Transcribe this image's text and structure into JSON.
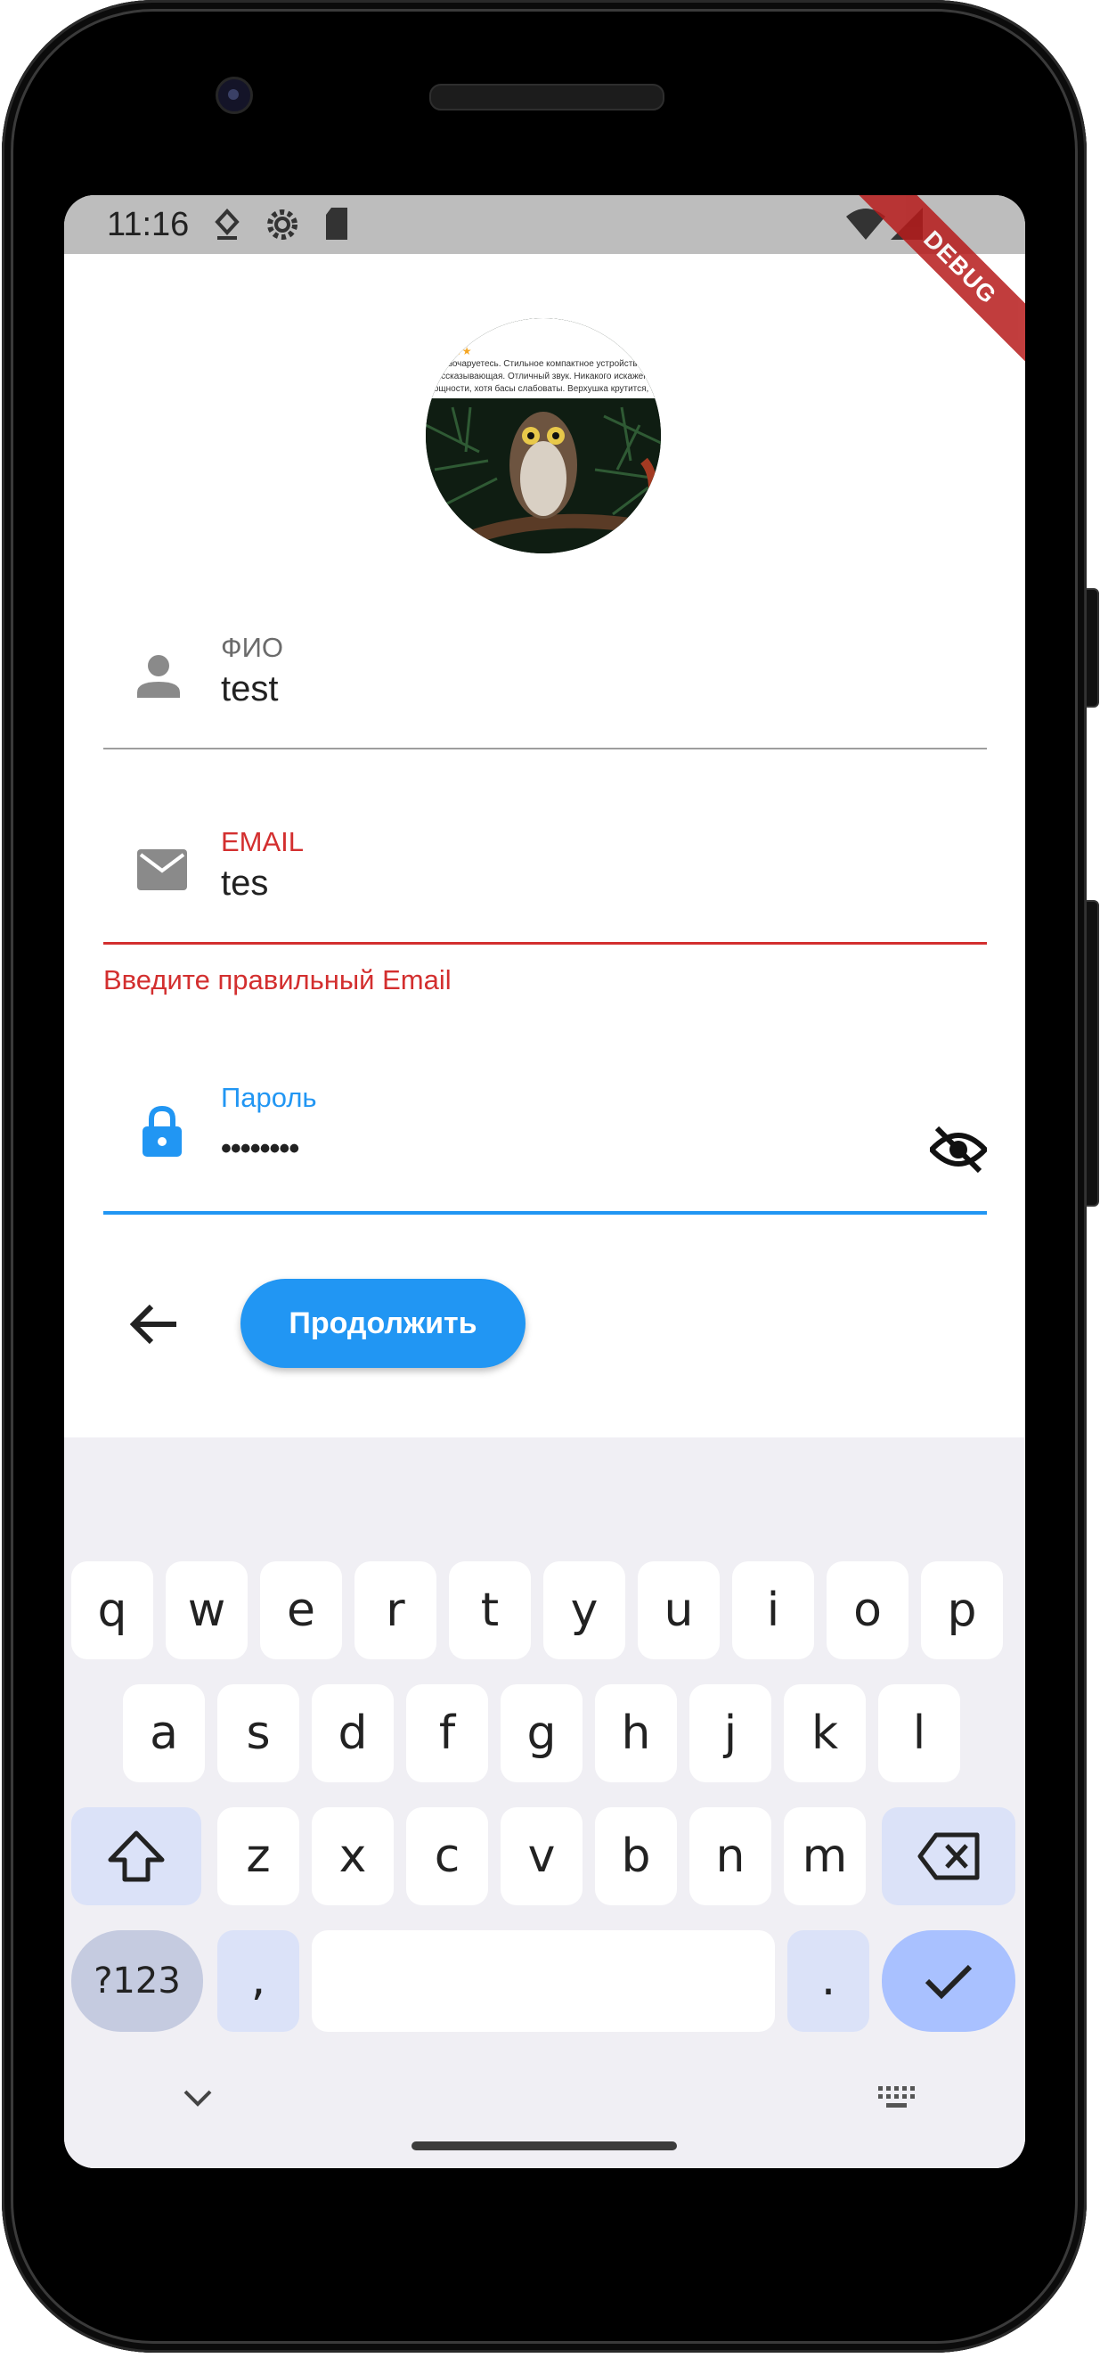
{
  "status_bar": {
    "time": "11:16",
    "debug_banner": "DEBUG"
  },
  "avatar": {
    "review_lines": [
      "е разочаруетесь. Стильное компактное устройство, гро",
      "рассказывающая. Отличный звук. Никакого искажения на полной",
      "мощности, хотя басы слабоваты. Верхушка крутится, это плюс"
    ]
  },
  "form": {
    "name": {
      "label": "ФИО",
      "value": "test",
      "icon": "person-icon"
    },
    "email": {
      "label": "EMAIL",
      "value": "tes",
      "error": "Введите правильный Email",
      "icon": "mail-icon"
    },
    "password": {
      "label": "Пароль",
      "value": "••••••••",
      "icon": "lock-icon",
      "toggle_icon": "eye-off-icon"
    }
  },
  "actions": {
    "continue_label": "Продолжить",
    "back_icon": "arrow-back-icon"
  },
  "keyboard": {
    "row1": [
      "q",
      "w",
      "e",
      "r",
      "t",
      "y",
      "u",
      "i",
      "o",
      "p"
    ],
    "row2": [
      "a",
      "s",
      "d",
      "f",
      "g",
      "h",
      "j",
      "k",
      "l"
    ],
    "row3": [
      "z",
      "x",
      "c",
      "v",
      "b",
      "n",
      "m"
    ],
    "symbols_label": "?123",
    "comma": ",",
    "period": "."
  },
  "colors": {
    "accent": "#2196f3",
    "error": "#d32f2f",
    "keyboard_bg": "#f0eff4",
    "status_bar": "#bdbdbd"
  }
}
